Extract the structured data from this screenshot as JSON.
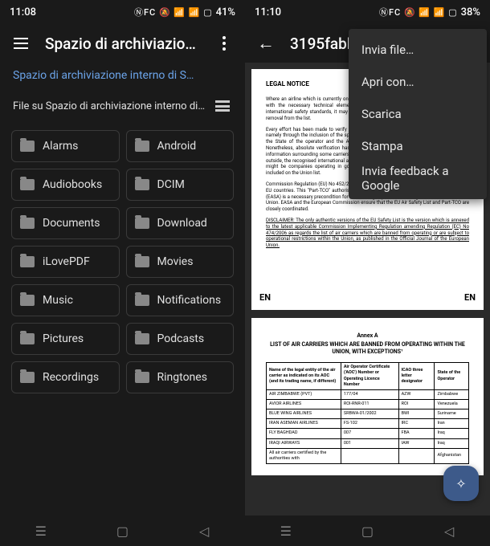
{
  "left": {
    "status": {
      "time": "11:08",
      "icons": "⬚ ⬚",
      "battery": "41%",
      "sig": "⊪ ⊘ ⊗ ⫽ ⬡"
    },
    "title": "Spazio di archiviazione i…",
    "breadcrumb": "Spazio di archiviazione interno di S…",
    "list_header": "File su Spazio di archiviazione interno di SAMS…",
    "folders": [
      "Alarms",
      "Android",
      "Audiobooks",
      "DCIM",
      "Documents",
      "Download",
      "iLovePDF",
      "Movies",
      "Music",
      "Notifications",
      "Pictures",
      "Podcasts",
      "Recordings",
      "Ringtones"
    ]
  },
  "right": {
    "status": {
      "time": "11:10",
      "icons": "⬚",
      "battery": "38%",
      "sig": "⊪ ⊘ ⊗ ⫽ ⬡"
    },
    "title": "3195fabb",
    "menu": [
      "Invia file…",
      "Apri con…",
      "Scarica",
      "Stampa",
      "Invia feedback a Google"
    ],
    "page1": {
      "title": "LEGAL NOTICE",
      "paras": [
        "Where an airline which is currently on the EU Air Safety List deems itself to be in conformity with the necessary technical elements and requirements prescribed by the applicable international safety standards, it may request the Commission to start the procedure for its removal from the list.",
        "Every effort has been made to verify the exact identity of all carriers included in the EU list, namely through the inclusion of the specific letter codes assigned to each airline by the ICAO, the State of the operator and the Air Operator Certificate (or Operating licence) number. Nonetheless, absolute verification has not been possible in all cases due to a total lack of information surrounding some carriers which may be operating on the border of or altogether outside, the recognised international aviation rules. It can therefore not be excluded that there might be companies operating in good faith under the same trading name as an airline included on the Union list.",
        "Commission Regulation (EU) No 452/2014 governs the authorisation of air operators from non-EU countries. This \"Part-TCO\" authorisation from the European Union Aviation Safety Agency (EASA) is a necessary precondition for undertaking any commercial flight to, from, or within the Union. EASA and the European Commission ensure that the EU Air Safety List and Part-TCO are closely coordinated.",
        "DISCLAIMER: The only authentic versions of the EU Safety List is the version which is annexed to the latest applicable Commission Implementing Regulation amending Regulation (EC) No 474/2006 as regards the list of air carriers which are banned from operating or are subject to operational restrictions within the Union, as published in the Official Journal of the European Union."
      ],
      "en": "EN"
    },
    "page2": {
      "annex": "Annex A",
      "title": "LIST OF AIR CARRIERS WHICH ARE BANNED FROM OPERATING WITHIN THE UNION, WITH EXCEPTIONS¹",
      "headers": [
        "Name of the legal entity of the air carrier as indicated on its AOC (and its trading name, if different)",
        "Air Operator Certificate ('AOC') Number or Operating Licence Number",
        "ICAO three letter designator",
        "State of the Operator"
      ],
      "rows": [
        [
          "AIR ZIMBABWE (PVT)",
          "177/04",
          "AZW",
          "Zimbabwe"
        ],
        [
          "AVIOR AIRLINES",
          "ROI-RNR-011",
          "ROI",
          "Venezuela"
        ],
        [
          "BLUE WING AIRLINES",
          "SRBWA-01/2002",
          "BWI",
          "Suriname"
        ],
        [
          "IRAN ASEMAN AIRLINES",
          "FS-102",
          "IRC",
          "Iran"
        ],
        [
          "FLY BAGHDAD",
          "007",
          "FBA",
          "Iraq"
        ],
        [
          "IRAQI AIRWAYS",
          "001",
          "IAW",
          "Iraq"
        ],
        [
          "All air carriers certified by the authorities with",
          "",
          "",
          "Afghanistan"
        ]
      ]
    }
  }
}
